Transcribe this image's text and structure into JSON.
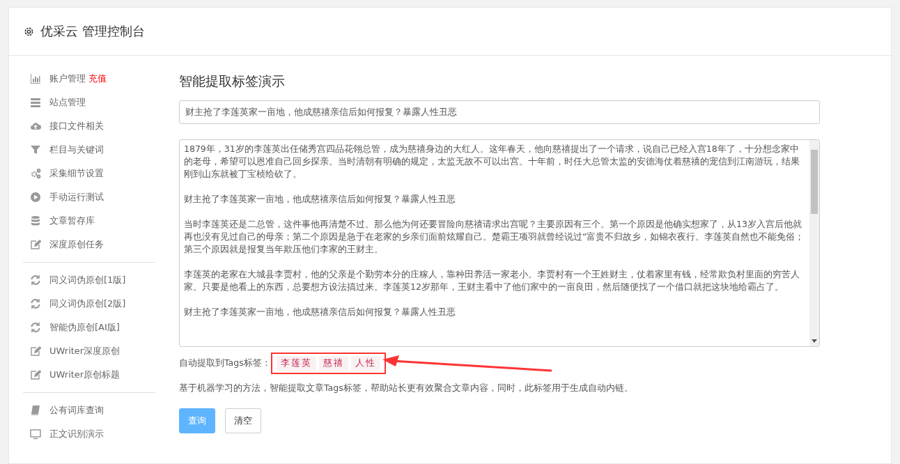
{
  "header": {
    "title": "优采云 管理控制台"
  },
  "sidebar": {
    "groups": [
      {
        "items": [
          {
            "kind": "chart",
            "label": "账户管理",
            "badge": "充值"
          },
          {
            "kind": "server",
            "label": "站点管理"
          },
          {
            "kind": "cloud",
            "label": "接口文件相关"
          },
          {
            "kind": "filter",
            "label": "栏目与关键词"
          },
          {
            "kind": "gears",
            "label": "采集细节设置"
          },
          {
            "kind": "play",
            "label": "手动运行测试"
          },
          {
            "kind": "database",
            "label": "文章暂存库"
          },
          {
            "kind": "edit",
            "label": "深度原创任务"
          }
        ]
      },
      {
        "items": [
          {
            "kind": "refresh",
            "label": "同义词伪原创[1版]"
          },
          {
            "kind": "refresh",
            "label": "同义词伪原创[2版]"
          },
          {
            "kind": "refresh",
            "label": "智能伪原创[AI版]"
          },
          {
            "kind": "edit",
            "label": "UWriter深度原创"
          },
          {
            "kind": "edit",
            "label": "UWriter原创标题"
          }
        ]
      },
      {
        "items": [
          {
            "kind": "book",
            "label": "公有词库查询"
          },
          {
            "kind": "monitor",
            "label": "正文识别演示"
          }
        ]
      }
    ]
  },
  "main": {
    "title": "智能提取标签演示",
    "title_field": {
      "value": "财主抢了李莲英家一亩地，他成慈禧亲信后如何报复？暴露人性丑恶"
    },
    "content_paragraphs": [
      "1879年，31岁的李莲英出任储秀宫四品花翎总管，成为慈禧身边的大红人。这年春天，他向慈禧提出了一个请求，说自己已经入宫18年了，十分想念家中的老母，希望可以恩准自己回乡探亲。当时清朝有明确的规定，太监无故不可以出宫。十年前，时任大总管太监的安德海仗着慈禧的宠信到江南游玩，结果刚到山东就被丁宝桢给砍了。",
      "财主抢了李莲英家一亩地，他成慈禧亲信后如何报复？暴露人性丑恶",
      "当时李莲英还是二总管，这件事他再清楚不过。那么他为何还要冒险向慈禧请求出宫呢？主要原因有三个。第一个原因是他确实想家了，从13岁入宫后他就再也没有见过自己的母亲；第二个原因是急于在老家的乡亲们面前炫耀自己。楚霸王项羽就曾经说过“富贵不归故乡，如锦衣夜行。李莲英自然也不能免俗；第三个原因就是报复当年欺压他们李家的王财主。",
      "李莲英的老家在大城县李贾村，他的父亲是个勤劳本分的庄稼人，靠种田养活一家老小。李贾村有一个王姓财主，仗着家里有钱，经常欺负村里面的穷苦人家。只要是他看上的东西，总要想方设法搞过来。李莲英12岁那年，王财主看中了他们家中的一亩良田，然后随便找了一个借口就把这块地给霸占了。",
      "财主抢了李莲英家一亩地，他成慈禧亲信后如何报复？暴露人性丑恶"
    ],
    "tags": {
      "label": "自动提取到Tags标签：",
      "items": [
        "李莲英",
        "慈禧",
        "人性"
      ],
      "highlighted": true
    },
    "description": "基于机器学习的方法，智能提取文章Tags标签，帮助站长更有效聚合文章内容，同时，此标签用于生成自动内链。",
    "buttons": [
      {
        "kind": "primary",
        "label": "查询"
      },
      {
        "kind": "default",
        "label": "清空"
      }
    ]
  }
}
